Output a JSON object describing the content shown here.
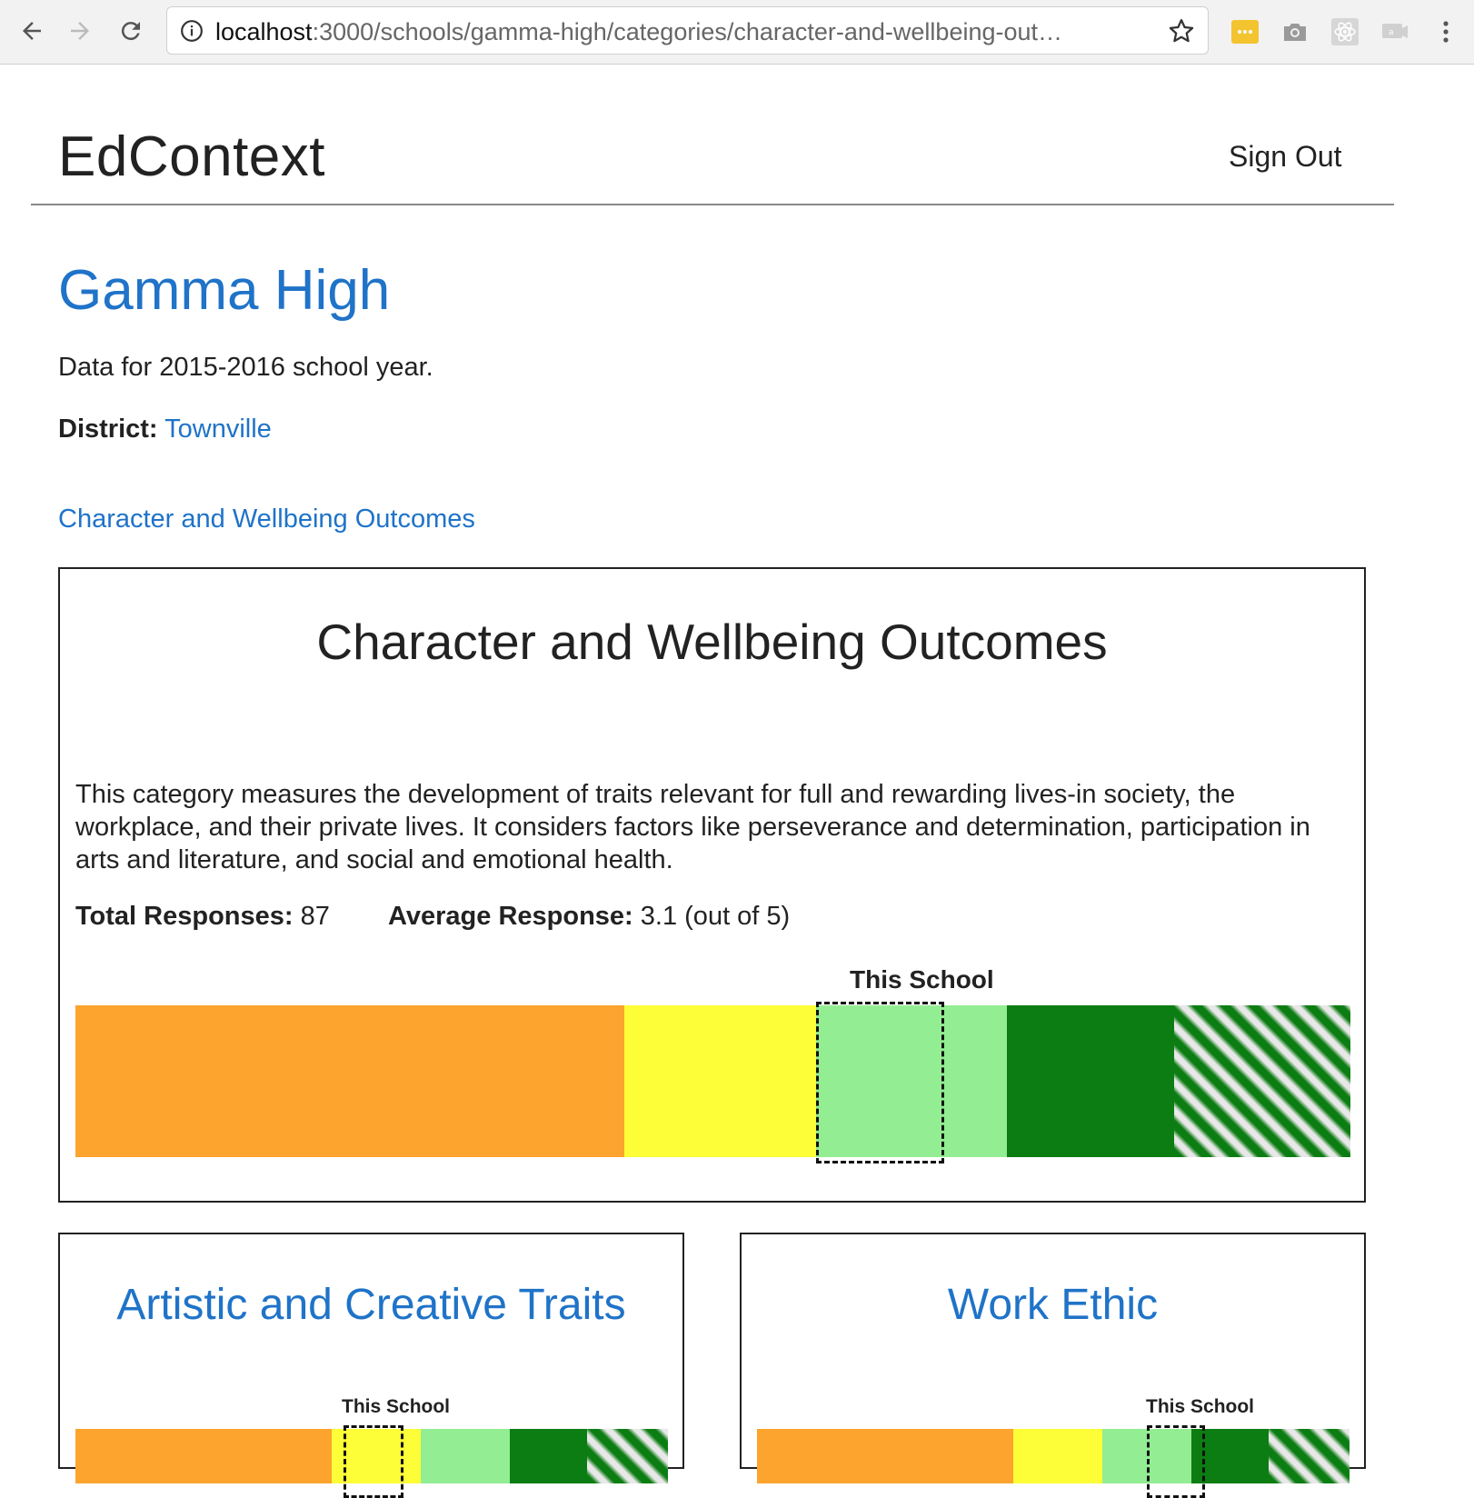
{
  "browser": {
    "url_host": "localhost",
    "url_rest": ":3000/schools/gamma-high/categories/character-and-wellbeing-out…"
  },
  "header": {
    "brand": "EdContext",
    "sign_out": "Sign Out"
  },
  "school": {
    "name": "Gamma High",
    "year_text": "Data for 2015-2016 school year.",
    "district_label": "District:",
    "district_name": "Townville"
  },
  "breadcrumb": "Character and Wellbeing Outcomes",
  "category": {
    "title": "Character and Wellbeing Outcomes",
    "description": "This category measures the development of traits relevant for full and rewarding lives-in society, the workplace, and their private lives. It considers factors like perseverance and determination, participation in arts and literature, and social and emotional health.",
    "total_responses_label": "Total Responses:",
    "total_responses_value": "87",
    "average_response_label": "Average Response:",
    "average_response_value": "3.1 (out of 5)",
    "marker_label": "This School"
  },
  "subcategories": [
    {
      "title": "Artistic and Creative Traits",
      "marker_label": "This School"
    },
    {
      "title": "Work Ethic",
      "marker_label": "This School"
    }
  ],
  "colors": {
    "link": "#1f73c8",
    "zone_orange": "#fca42d",
    "zone_yellow": "#fdfd38",
    "zone_light_green": "#93ed93",
    "zone_dark_green": "#0c7d12",
    "hatch_light": "#e8e8e8"
  },
  "icons": [
    "back-arrow-icon",
    "forward-arrow-icon",
    "reload-icon",
    "info-icon",
    "star-icon",
    "extension-icons",
    "menu-dots-icon"
  ]
}
